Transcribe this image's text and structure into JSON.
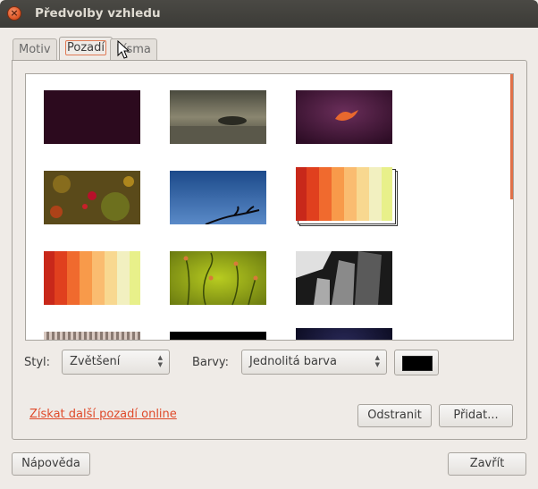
{
  "window": {
    "title": "Předvolby vzhledu"
  },
  "tabs": [
    {
      "label": "Motiv"
    },
    {
      "label": "Pozadí"
    },
    {
      "label": "Písma"
    }
  ],
  "controls": {
    "style_label": "Styl:",
    "style_value": "Zvětšení",
    "colors_label": "Barvy:",
    "colors_value": "Jednolitá barva",
    "color_swatch": "#000000"
  },
  "actions": {
    "online_link": "Získat další pozadí online",
    "remove": "Odstranit",
    "add": "Přidat..."
  },
  "footer": {
    "help": "Nápověda",
    "close": "Zavřít"
  },
  "colors": {
    "accent": "#df4a2a",
    "titlebar": "#3c3b37"
  }
}
